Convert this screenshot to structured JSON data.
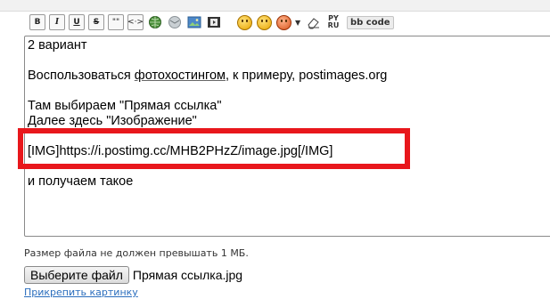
{
  "toolbar": {
    "bold": "B",
    "italic": "I",
    "underline": "U",
    "strike": "S",
    "quote": "\"\"",
    "code": "<·>",
    "pyru": "PY\nRU",
    "bbcode": "bb code"
  },
  "editor": {
    "lines": [
      "2 вариант",
      "",
      "Воспользоваться ",
      "",
      "Там выбираем \"Прямая ссылка\"",
      "Далее здесь \"Изображение\"",
      "",
      "[IMG]https://i.postimg.cc/MHB2PHzZ/image.jpg[/IMG]",
      "",
      "и получаем такое"
    ],
    "line3_link": "фотохостингом",
    "line3_tail": ", к примеру, postimages.org"
  },
  "note": "Размер файла не должен превышать 1 МБ.",
  "file": {
    "button_label": "Выберите файл",
    "chosen_name": "Прямая ссылка.jpg"
  },
  "attach_link": "Прикрепить картинку",
  "colors": {
    "highlight": "#e8171c",
    "link": "#2a6dbd"
  }
}
